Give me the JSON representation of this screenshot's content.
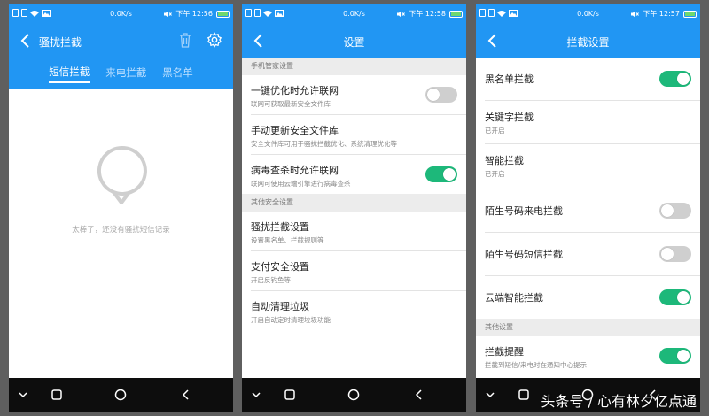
{
  "status": {
    "speed": "0.0K/s",
    "screens": [
      {
        "time": "下午 12:56"
      },
      {
        "time": "下午 12:58"
      },
      {
        "time": "下午 12:57"
      }
    ]
  },
  "screen1": {
    "title": "骚扰拦截",
    "tabs": [
      "短信拦截",
      "来电拦截",
      "黑名单"
    ],
    "empty_text": "太棒了，还没有骚扰短信记录"
  },
  "screen2": {
    "title": "设置",
    "sections": [
      {
        "header": "手机管家设置",
        "items": [
          {
            "title": "一键优化时允许联网",
            "sub": "联网可获取最新安全文件库",
            "toggle": "off"
          },
          {
            "title": "手动更新安全文件库",
            "sub": "安全文件库可用于骚扰拦截优化、系统清理优化等"
          },
          {
            "title": "病毒查杀时允许联网",
            "sub": "联网可使用云端引擎进行病毒查杀",
            "toggle": "on"
          }
        ]
      },
      {
        "header": "其他安全设置",
        "items": [
          {
            "title": "骚扰拦截设置",
            "sub": "设置黑名单、拦截规则等"
          },
          {
            "title": "支付安全设置",
            "sub": "开启反钓鱼等"
          },
          {
            "title": "自动清理垃圾",
            "sub": "开启自动定时清理垃圾功能"
          }
        ]
      }
    ]
  },
  "screen3": {
    "title": "拦截设置",
    "items": [
      {
        "title": "黑名单拦截",
        "toggle": "on"
      },
      {
        "title": "关键字拦截",
        "sub": "已开启"
      },
      {
        "title": "智能拦截",
        "sub": "已开启"
      },
      {
        "title": "陌生号码来电拦截",
        "toggle": "off"
      },
      {
        "title": "陌生号码短信拦截",
        "toggle": "off"
      },
      {
        "title": "云端智能拦截",
        "toggle": "on"
      }
    ],
    "other_header": "其他设置",
    "other_items": [
      {
        "title": "拦截提醒",
        "sub": "拦截到短信/来电时在通知中心提示",
        "toggle": "on"
      }
    ]
  },
  "watermark": "头条号 / 心有林夕亿点通",
  "colors": {
    "primary": "#2196f3",
    "toggle_on": "#1db87a",
    "toggle_off": "#cfcfcf"
  }
}
